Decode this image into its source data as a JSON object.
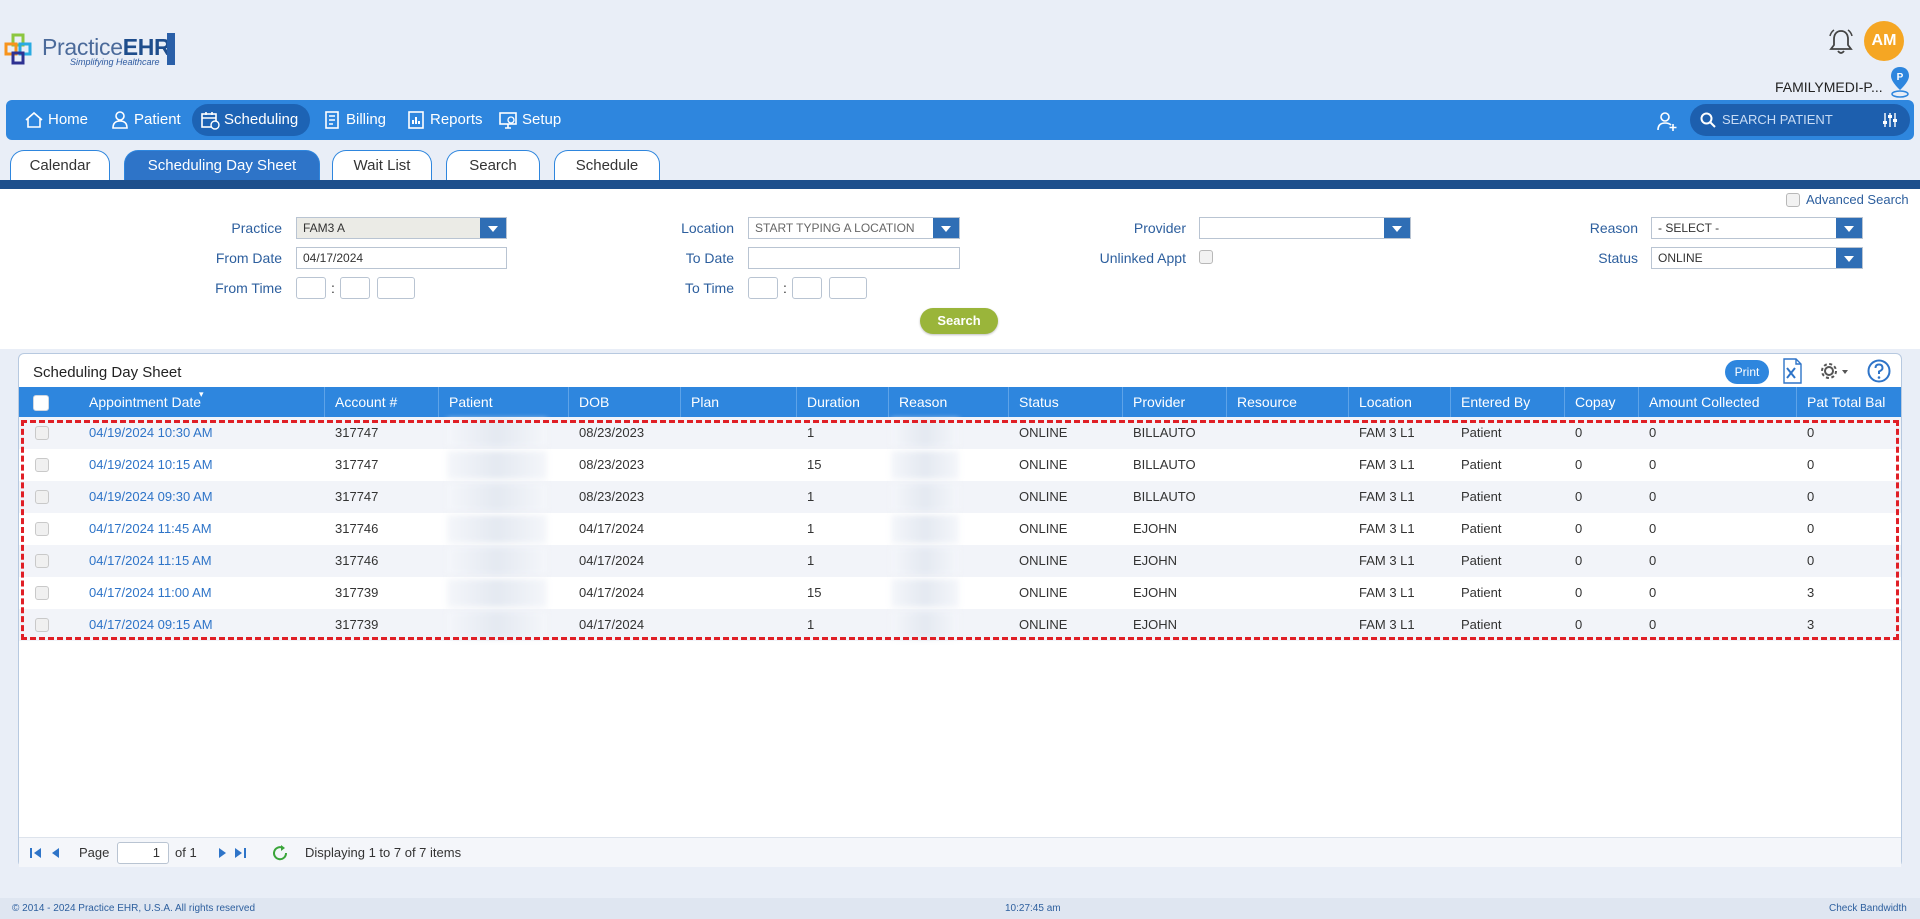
{
  "brand": {
    "name_part1": "Practice",
    "name_part2": "EHR",
    "tagline": "Simplifying Healthcare"
  },
  "user": {
    "initials": "AM",
    "practice_name": "FAMILYMEDI-P...",
    "pin_letter": "P"
  },
  "nav": {
    "items": [
      {
        "label": "Home",
        "icon": "home-icon"
      },
      {
        "label": "Patient",
        "icon": "user-icon"
      },
      {
        "label": "Scheduling",
        "icon": "calendar-icon",
        "active": true
      },
      {
        "label": "Billing",
        "icon": "billing-icon"
      },
      {
        "label": "Reports",
        "icon": "reports-icon"
      },
      {
        "label": "Setup",
        "icon": "setup-icon"
      }
    ],
    "search_placeholder": "SEARCH PATIENT"
  },
  "tabs": [
    "Calendar",
    "Scheduling Day Sheet",
    "Wait List",
    "Search",
    "Schedule"
  ],
  "active_tab": "Scheduling Day Sheet",
  "form": {
    "advanced_search": "Advanced Search",
    "practice_label": "Practice",
    "practice_value": "FAM3 A",
    "from_date_label": "From Date",
    "from_date_value": "04/17/2024",
    "from_time_label": "From Time",
    "location_label": "Location",
    "location_placeholder": "START TYPING A LOCATION",
    "to_date_label": "To Date",
    "to_date_value": "",
    "to_time_label": "To Time",
    "provider_label": "Provider",
    "provider_value": "",
    "unlinked_label": "Unlinked Appt",
    "reason_label": "Reason",
    "reason_value": "- SELECT -",
    "status_label": "Status",
    "status_value": "ONLINE",
    "search_button": "Search",
    "colon": ":"
  },
  "grid": {
    "title": "Scheduling Day Sheet",
    "print_label": "Print",
    "columns": [
      "Appointment Date",
      "Account #",
      "Patient",
      "DOB",
      "Plan",
      "Duration",
      "Reason",
      "Status",
      "Provider",
      "Resource",
      "Location",
      "Entered By",
      "Copay",
      "Amount Collected",
      "Pat Total Bal"
    ],
    "rows": [
      {
        "appt": "04/19/2024 10:30 AM",
        "account": "317747",
        "dob": "08/23/2023",
        "plan": "",
        "duration": "1",
        "status": "ONLINE",
        "provider": "BILLAUTO",
        "resource": "",
        "location": "FAM 3 L1",
        "entered_by": "Patient",
        "copay": "0",
        "amount_collected": "0",
        "pat_total_bal": "0"
      },
      {
        "appt": "04/19/2024 10:15 AM",
        "account": "317747",
        "dob": "08/23/2023",
        "plan": "",
        "duration": "15",
        "status": "ONLINE",
        "provider": "BILLAUTO",
        "resource": "",
        "location": "FAM 3 L1",
        "entered_by": "Patient",
        "copay": "0",
        "amount_collected": "0",
        "pat_total_bal": "0"
      },
      {
        "appt": "04/19/2024 09:30 AM",
        "account": "317747",
        "dob": "08/23/2023",
        "plan": "",
        "duration": "1",
        "status": "ONLINE",
        "provider": "BILLAUTO",
        "resource": "",
        "location": "FAM 3 L1",
        "entered_by": "Patient",
        "copay": "0",
        "amount_collected": "0",
        "pat_total_bal": "0"
      },
      {
        "appt": "04/17/2024 11:45 AM",
        "account": "317746",
        "dob": "04/17/2024",
        "plan": "",
        "duration": "1",
        "status": "ONLINE",
        "provider": "EJOHN",
        "resource": "",
        "location": "FAM 3 L1",
        "entered_by": "Patient",
        "copay": "0",
        "amount_collected": "0",
        "pat_total_bal": "0"
      },
      {
        "appt": "04/17/2024 11:15 AM",
        "account": "317746",
        "dob": "04/17/2024",
        "plan": "",
        "duration": "1",
        "status": "ONLINE",
        "provider": "EJOHN",
        "resource": "",
        "location": "FAM 3 L1",
        "entered_by": "Patient",
        "copay": "0",
        "amount_collected": "0",
        "pat_total_bal": "0"
      },
      {
        "appt": "04/17/2024 11:00 AM",
        "account": "317739",
        "dob": "04/17/2024",
        "plan": "",
        "duration": "15",
        "status": "ONLINE",
        "provider": "EJOHN",
        "resource": "",
        "location": "FAM 3 L1",
        "entered_by": "Patient",
        "copay": "0",
        "amount_collected": "0",
        "pat_total_bal": "3"
      },
      {
        "appt": "04/17/2024 09:15 AM",
        "account": "317739",
        "dob": "04/17/2024",
        "plan": "",
        "duration": "1",
        "status": "ONLINE",
        "provider": "EJOHN",
        "resource": "",
        "location": "FAM 3 L1",
        "entered_by": "Patient",
        "copay": "0",
        "amount_collected": "0",
        "pat_total_bal": "3"
      }
    ]
  },
  "pager": {
    "page_label": "Page",
    "page_value": "1",
    "of_label": "of 1",
    "display_text": "Displaying 1 to 7 of 7 items"
  },
  "footer": {
    "copyright": "© 2014 - 2024 Practice EHR, U.S.A. All rights reserved",
    "time": "10:27:45 am",
    "link": "Check Bandwidth"
  },
  "colors": {
    "nav_blue": "#2e86de",
    "nav_active": "#1d63b4",
    "accent_green": "#9ab53a",
    "avatar_orange": "#f5a623",
    "highlight_red": "#e01f26"
  }
}
